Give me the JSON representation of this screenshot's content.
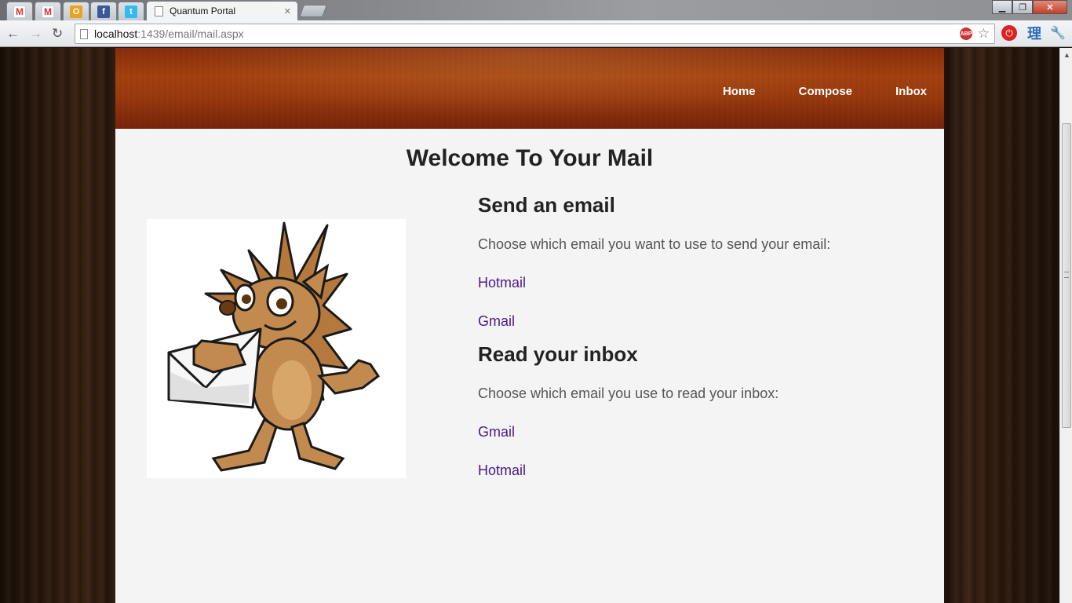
{
  "browser": {
    "pinned_tabs": [
      {
        "name": "gmail-tab-1",
        "icon": "gmail-icon",
        "glyph": "M"
      },
      {
        "name": "gmail-tab-2",
        "icon": "gmail-icon",
        "glyph": "M"
      },
      {
        "name": "outlook-tab",
        "icon": "outlook-icon",
        "glyph": "O"
      },
      {
        "name": "facebook-tab",
        "icon": "facebook-icon",
        "glyph": "f"
      },
      {
        "name": "twitter-tab",
        "icon": "twitter-icon",
        "glyph": "t"
      }
    ],
    "active_tab_title": "Quantum Portal",
    "url_host": "localhost",
    "url_path": ":1439/email/mail.aspx",
    "abp_label": "ABP",
    "kanji_ext": "理"
  },
  "site": {
    "nav": {
      "home": "Home",
      "compose": "Compose",
      "inbox": "Inbox"
    },
    "welcome": "Welcome To Your Mail",
    "send": {
      "heading": "Send an email",
      "prompt": "Choose which email you want to use to send your email:",
      "links": [
        "Hotmail",
        "Gmail"
      ]
    },
    "read": {
      "heading": "Read your inbox",
      "prompt": "Choose which email you use to read your inbox:",
      "links": [
        "Gmail",
        "Hotmail"
      ]
    }
  },
  "colors": {
    "header": "#9c3b0e",
    "link": "#4b1b86",
    "content_bg": "#f4f4f4"
  }
}
